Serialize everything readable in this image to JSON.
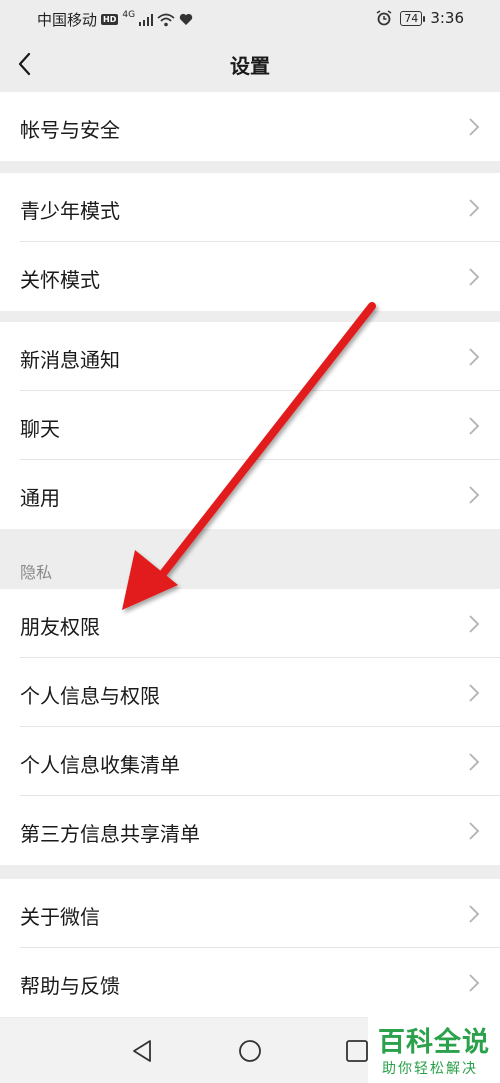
{
  "status": {
    "carrier": "中国移动",
    "hd": "HD",
    "network": "4G",
    "battery": "74",
    "time": "3:36"
  },
  "nav": {
    "title": "设置"
  },
  "groups": [
    {
      "items": [
        {
          "label": "帐号与安全"
        }
      ]
    },
    {
      "items": [
        {
          "label": "青少年模式"
        },
        {
          "label": "关怀模式"
        }
      ]
    },
    {
      "items": [
        {
          "label": "新消息通知"
        },
        {
          "label": "聊天"
        },
        {
          "label": "通用"
        }
      ]
    },
    {
      "section_label": "隐私",
      "items": [
        {
          "label": "朋友权限"
        },
        {
          "label": "个人信息与权限"
        },
        {
          "label": "个人信息收集清单"
        },
        {
          "label": "第三方信息共享清单"
        }
      ]
    },
    {
      "items": [
        {
          "label": "关于微信"
        },
        {
          "label": "帮助与反馈"
        }
      ]
    }
  ],
  "watermark": {
    "title": "百科全说",
    "subtitle": "助你轻松解决"
  },
  "colors": {
    "accent": "#e21b1b",
    "watermark": "#2aa14a",
    "background": "#ededed"
  }
}
